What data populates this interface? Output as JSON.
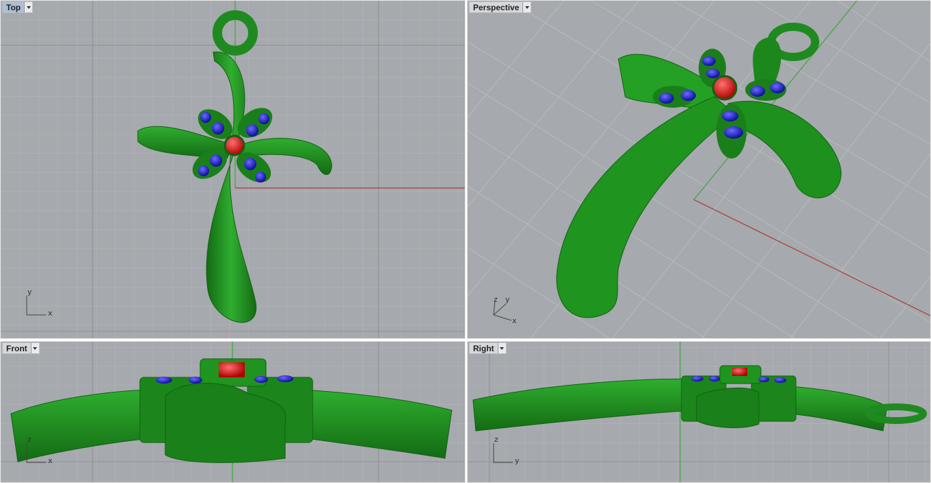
{
  "viewports": {
    "top": {
      "title": "Top",
      "axis_a": "y",
      "axis_b": "x"
    },
    "perspective": {
      "title": "Perspective",
      "axis_a": "z",
      "axis_b": "y",
      "axis_c": "x"
    },
    "front": {
      "title": "Front",
      "axis_a": "z",
      "axis_b": "x"
    },
    "right": {
      "title": "Right",
      "axis_a": "z",
      "axis_b": "y"
    }
  },
  "colors": {
    "viewport_bg": "#a6a9ad",
    "grid_minor": "#b5b8bb",
    "grid_major": "#8e9195",
    "x_axis": "#b03a3a",
    "y_axis": "#3aa83a",
    "model_green": "#1f8a1f",
    "gem_blue": "#1a1ad0",
    "gem_red": "#e01a1a"
  }
}
